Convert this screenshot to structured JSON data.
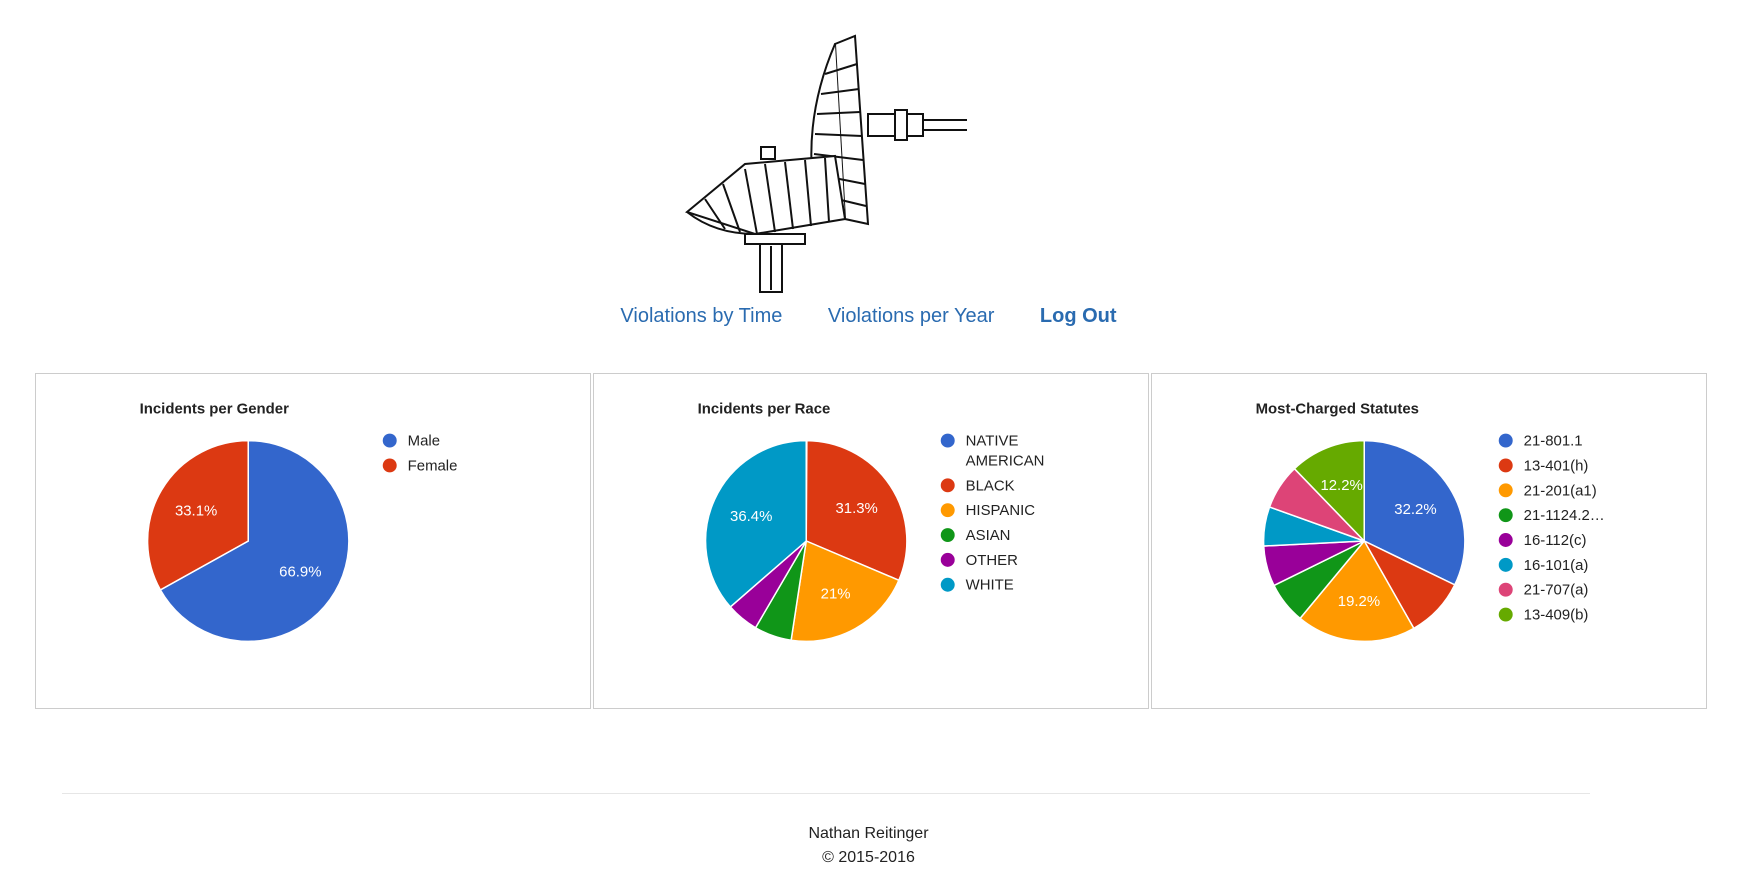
{
  "nav": {
    "links": [
      "Violations by Time",
      "Violations per Year"
    ],
    "logout_label": "Log Out"
  },
  "colors": {
    "link": "#2a6bb0",
    "palette": [
      "#3366cc",
      "#dc3912",
      "#ff9900",
      "#109618",
      "#990099",
      "#0099c6",
      "#dd4477",
      "#66aa00"
    ]
  },
  "logo": {
    "icon": "satellite-dish-icon"
  },
  "chart_data": [
    {
      "type": "pie",
      "title": "Incidents per Gender",
      "categories": [
        "Male",
        "Female"
      ],
      "values": [
        66.9,
        33.1
      ],
      "labels": [
        "66.9%",
        "33.1%"
      ],
      "colors": [
        "#3366cc",
        "#dc3912"
      ],
      "legend": "right"
    },
    {
      "type": "pie",
      "title": "Incidents per Race",
      "categories": [
        "NATIVE AMERICAN",
        "BLACK",
        "HISPANIC",
        "ASIAN",
        "OTHER",
        "WHITE"
      ],
      "values": [
        0.1,
        31.3,
        21.0,
        6.0,
        5.2,
        36.4
      ],
      "labels": [
        "",
        "31.3%",
        "21%",
        "",
        "",
        "36.4%"
      ],
      "colors": [
        "#3366cc",
        "#dc3912",
        "#ff9900",
        "#109618",
        "#990099",
        "#0099c6"
      ],
      "legend": "right"
    },
    {
      "type": "pie",
      "title": "Most-Charged Statutes",
      "categories": [
        "21-801.1",
        "13-401(h)",
        "21-201(a1)",
        "21-1124.2…",
        "16-112(c)",
        "16-101(a)",
        "21-707(a)",
        "13-409(b)"
      ],
      "values": [
        32.2,
        9.6,
        19.2,
        6.7,
        6.5,
        6.3,
        7.3,
        12.2
      ],
      "labels": [
        "32.2%",
        "",
        "19.2%",
        "",
        "",
        "",
        "",
        "12.2%"
      ],
      "colors": [
        "#3366cc",
        "#dc3912",
        "#ff9900",
        "#109618",
        "#990099",
        "#0099c6",
        "#dd4477",
        "#66aa00"
      ],
      "legend": "right"
    }
  ],
  "footer": {
    "author": "Nathan Reitinger",
    "copyright": "© 2015-2016"
  }
}
